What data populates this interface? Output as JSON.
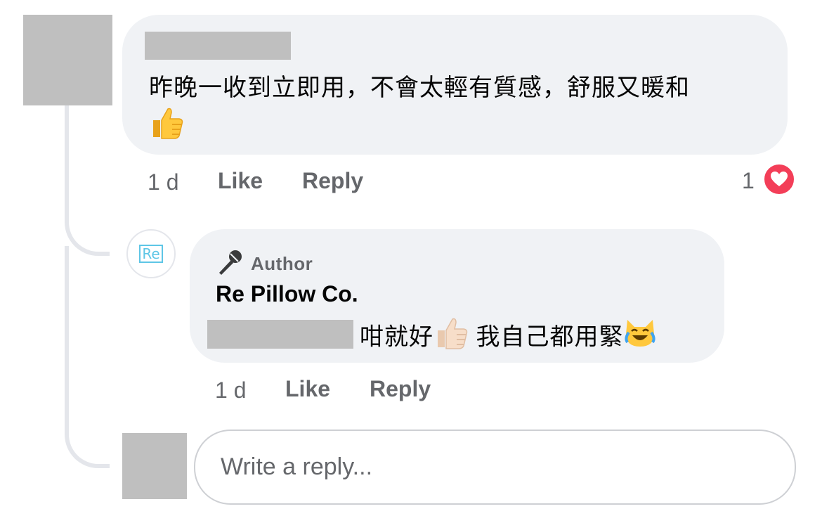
{
  "comment": {
    "text": "昨晚一收到立即用，不會太輕有質感，舒服又暖和",
    "emoji": "thumbs-up",
    "time": "1 d",
    "like_label": "Like",
    "reply_label": "Reply",
    "reaction_count": "1",
    "reaction_type": "heart"
  },
  "reply": {
    "avatar_logo": "Re",
    "badge_label": "Author",
    "author_name": "Re Pillow Co.",
    "text_part1": "咁就好",
    "text_part2": " 我自己都用緊",
    "emojis": [
      "thumbs-up-light",
      "cat-tears-of-joy"
    ],
    "time": "1 d",
    "like_label": "Like",
    "reply_label": "Reply"
  },
  "composer": {
    "placeholder": "Write a reply..."
  },
  "colors": {
    "bubble": "#f0f2f5",
    "meta_text": "#65676b",
    "thread_line": "#e4e6eb",
    "heart": "#f33e58",
    "logo": "#5ec6e6"
  }
}
